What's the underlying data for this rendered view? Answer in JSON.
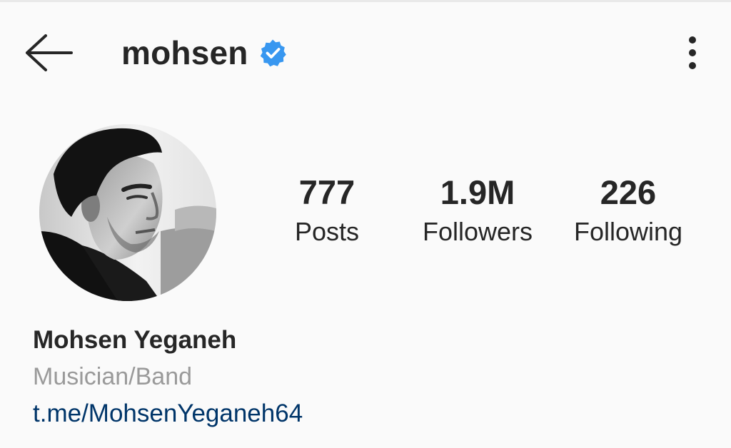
{
  "header": {
    "title": "mohsen",
    "verified": true,
    "accent_color": "#3897f0"
  },
  "stats": {
    "posts": {
      "value": "777",
      "label": "Posts"
    },
    "followers": {
      "value": "1.9M",
      "label": "Followers"
    },
    "following": {
      "value": "226",
      "label": "Following"
    }
  },
  "bio": {
    "name": "Mohsen Yeganeh",
    "category": "Musician/Band",
    "link": "t.me/MohsenYeganeh64"
  },
  "icons": {
    "back": "arrow-left-icon",
    "verified": "verified-badge-icon",
    "more": "more-vertical-icon"
  }
}
